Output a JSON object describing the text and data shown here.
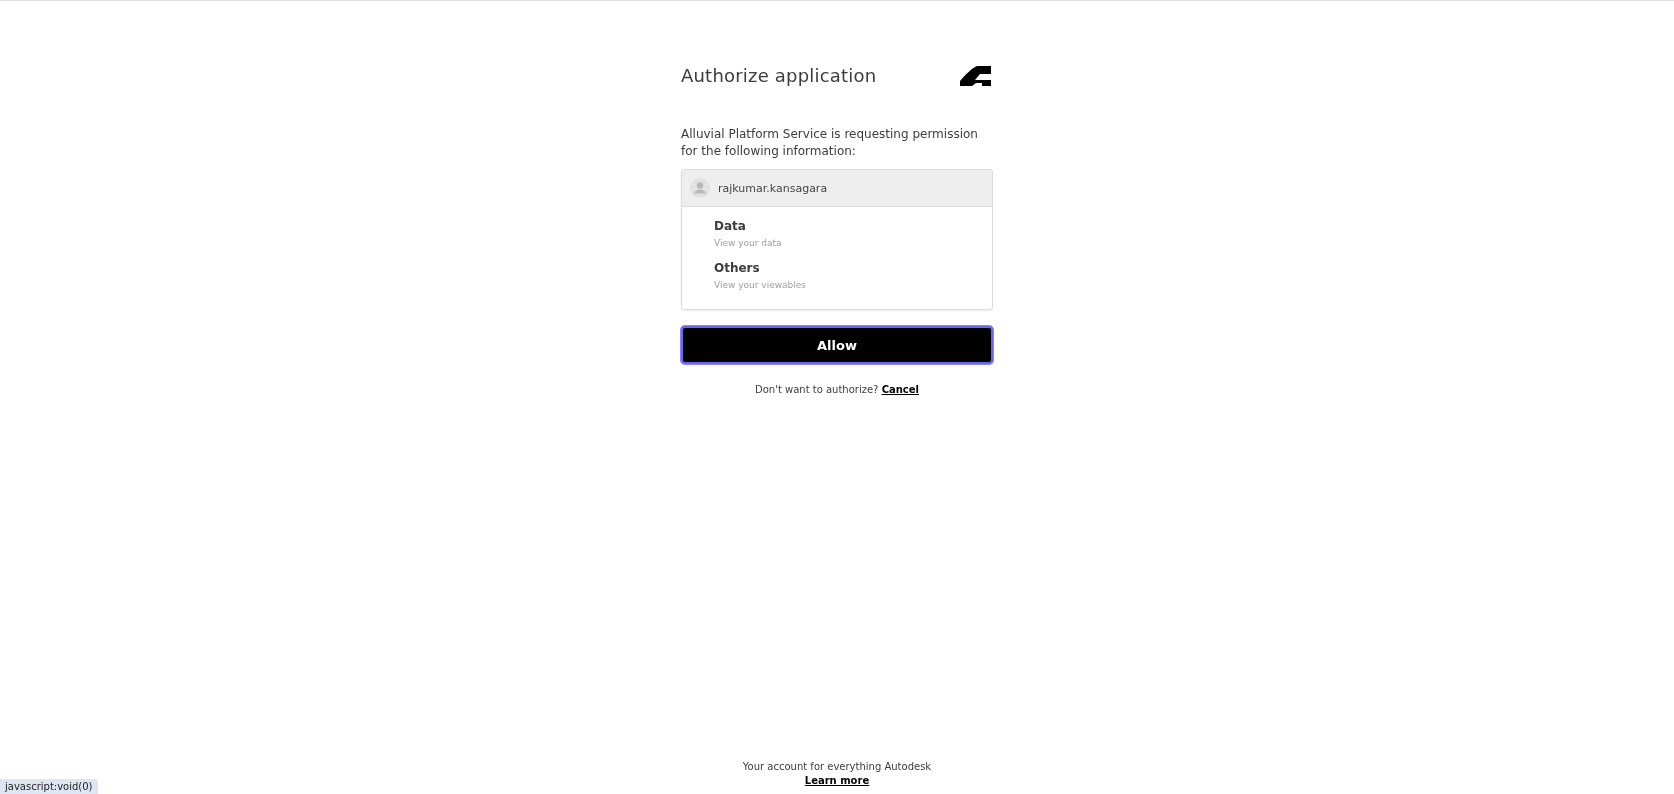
{
  "title": "Authorize application",
  "description": "Alluvial Platform Service is requesting permission for the following information:",
  "account": {
    "username": "rajkumar.kansagara"
  },
  "permissions": [
    {
      "name": "Data",
      "detail": "View your data"
    },
    {
      "name": "Others",
      "detail": "View your viewables"
    }
  ],
  "allow_button": {
    "label": "Allow",
    "focused": true
  },
  "decline": {
    "prompt": "Don't want to authorize?",
    "link": "Cancel"
  },
  "footer": {
    "tagline": "Your account for everything Autodesk",
    "link": "Learn more"
  },
  "status_bar": {
    "url": "javascript:void(0)"
  }
}
